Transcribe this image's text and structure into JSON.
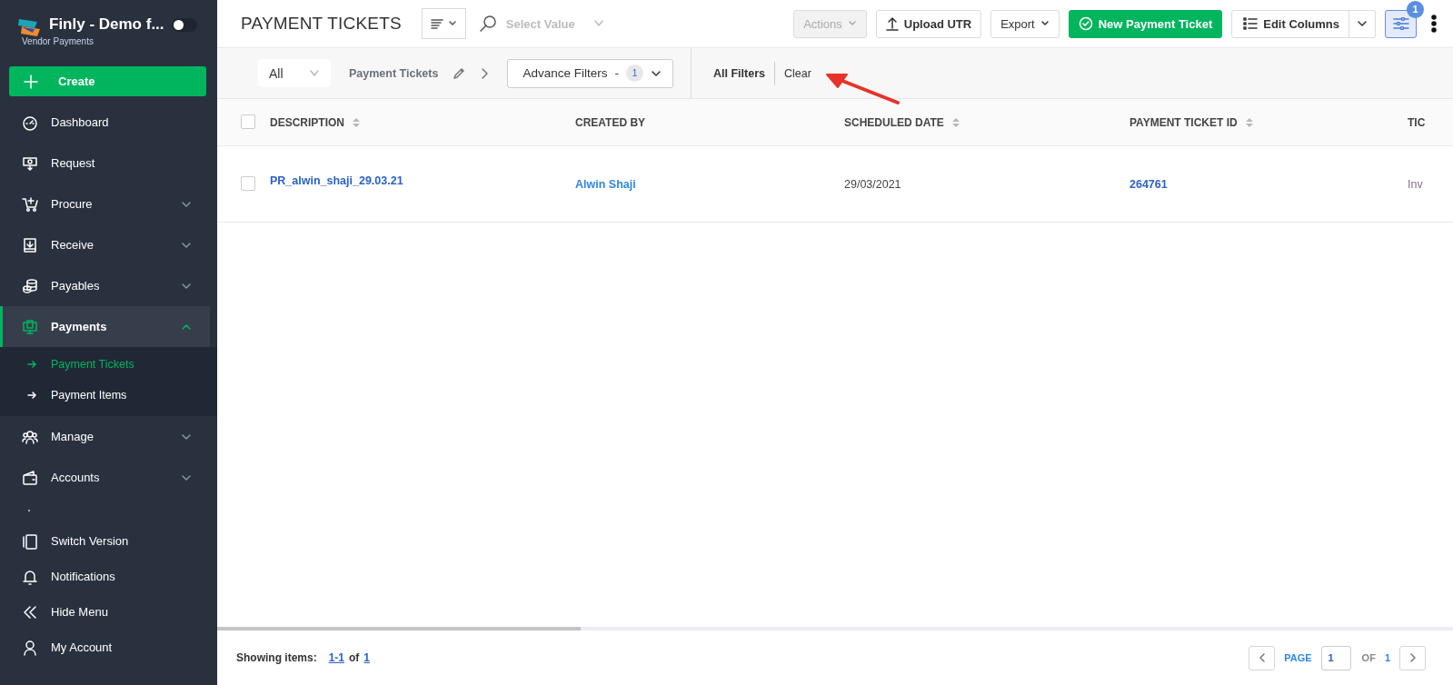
{
  "sidebar": {
    "app_title": "Finly - Demo f...",
    "app_subtitle": "Vendor Payments",
    "theme_toggle": {
      "on": false
    },
    "create_button": "Create",
    "items": [
      {
        "label": "Dashboard",
        "selected": false
      },
      {
        "label": "Request",
        "selected": false
      },
      {
        "label": "Procure",
        "selected": false,
        "expanded": false
      },
      {
        "label": "Receive",
        "selected": false,
        "expanded": false
      },
      {
        "label": "Payables",
        "selected": false,
        "expanded": false
      },
      {
        "label": "Payments",
        "selected": true,
        "expanded": true,
        "children": [
          {
            "label": "Payment Tickets",
            "selected": true
          },
          {
            "label": "Payment Items",
            "selected": false
          }
        ]
      },
      {
        "label": "Manage",
        "selected": false,
        "expanded": false
      },
      {
        "label": "Accounts",
        "selected": false,
        "expanded": false
      }
    ],
    "bottom_items": [
      {
        "label": "Switch Version"
      },
      {
        "label": "Notifications"
      },
      {
        "label": "Hide Menu"
      },
      {
        "label": "My Account"
      }
    ]
  },
  "header": {
    "title": "PAYMENT TICKETS",
    "search": {
      "placeholder": "Select Value"
    },
    "buttons": [
      {
        "kind": "plain",
        "label": "Actions",
        "caret": true,
        "disabled": true
      },
      {
        "kind": "upload",
        "label": "Upload UTR",
        "caret": false,
        "disabled": false
      },
      {
        "kind": "plain",
        "label": "Export",
        "caret": true,
        "disabled": false
      },
      {
        "kind": "primary",
        "label": "New Payment Ticket",
        "caret": false,
        "disabled": false
      },
      {
        "kind": "split",
        "label": "Edit Columns",
        "caret": true,
        "disabled": false
      }
    ],
    "filter_toggle": {
      "selected": true,
      "badge": "1"
    }
  },
  "filter_bar": {
    "view_select": "All",
    "view_name": "Payment Tickets",
    "advance_filters": {
      "label": "Advance Filters",
      "separator": "-",
      "count": "1"
    },
    "all_filters": "All Filters",
    "clear": "Clear"
  },
  "table": {
    "select_all_checked": false,
    "columns": [
      {
        "label": "DESCRIPTION",
        "sortable": true
      },
      {
        "label": "CREATED BY",
        "sortable": false
      },
      {
        "label": "SCHEDULED DATE",
        "sortable": true
      },
      {
        "label": "PAYMENT TICKET ID",
        "sortable": true
      },
      {
        "label": "TIC",
        "sortable": false
      }
    ],
    "rows": [
      {
        "checked": false,
        "cells": [
          {
            "text": "PR_alwin_shaji_29.03.21",
            "kind": "link"
          },
          {
            "text": "Alwin Shaji",
            "kind": "link"
          },
          {
            "text": "29/03/2021",
            "kind": "text"
          },
          {
            "text": "264761",
            "kind": "link"
          },
          {
            "text": "Inv",
            "kind": "muted"
          }
        ]
      }
    ]
  },
  "footer": {
    "showing_label": "Showing items:",
    "range": "1-1",
    "of": "of",
    "total": "1",
    "page_label": "PAGE",
    "page": "1",
    "of_label": "OF",
    "page_total": "1"
  }
}
